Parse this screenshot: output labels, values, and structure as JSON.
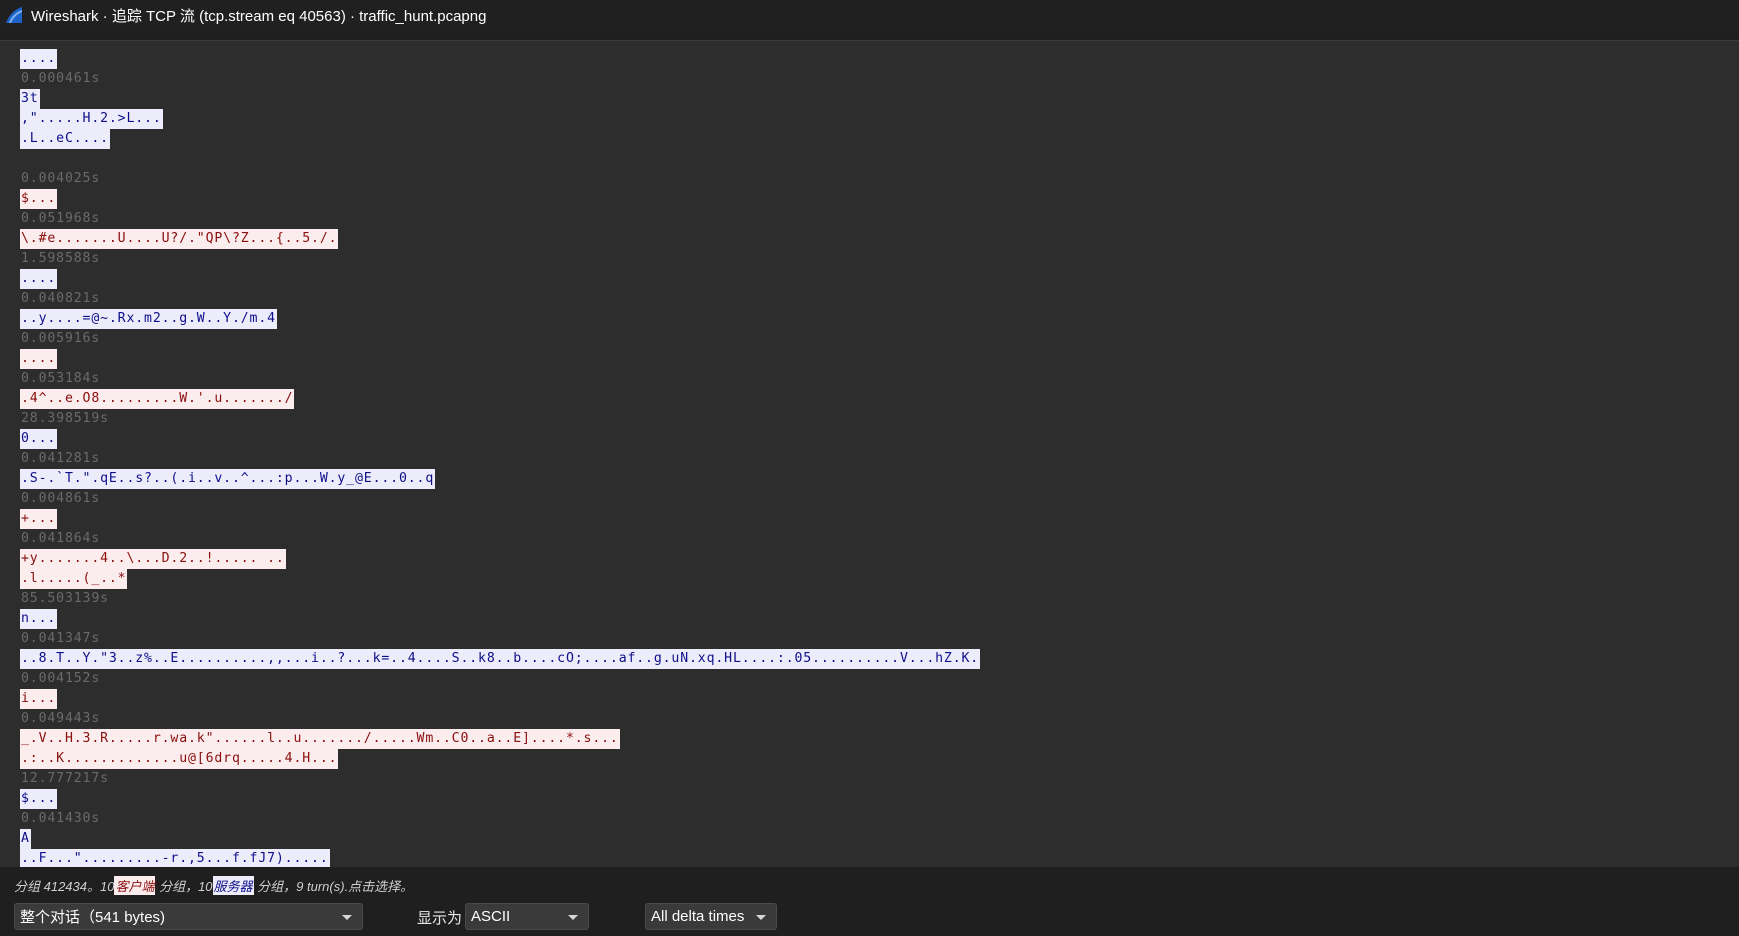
{
  "window": {
    "title": "Wireshark · 追踪 TCP 流 (tcp.stream eq 40563) · traffic_hunt.pcapng"
  },
  "stream": [
    {
      "type": "server",
      "text": "...."
    },
    {
      "type": "ts",
      "text": "0.000461s"
    },
    {
      "type": "server",
      "text": "3t"
    },
    {
      "type": "server",
      "text": ",\".....H.2.>L..."
    },
    {
      "type": "server",
      "text": ".L..eC...."
    },
    {
      "type": "blank",
      "text": ""
    },
    {
      "type": "ts",
      "text": "0.004025s"
    },
    {
      "type": "client",
      "text": "$..."
    },
    {
      "type": "ts",
      "text": "0.051968s"
    },
    {
      "type": "client",
      "text": "\\.#e.......U....U?/.\"QP\\?Z...{..5./."
    },
    {
      "type": "ts",
      "text": "1.598588s"
    },
    {
      "type": "server",
      "text": "...."
    },
    {
      "type": "ts",
      "text": "0.040821s"
    },
    {
      "type": "server",
      "text": "..y....=@~.Rx.m2..g.W..Y./m.4"
    },
    {
      "type": "ts",
      "text": "0.005916s"
    },
    {
      "type": "client",
      "text": "...."
    },
    {
      "type": "ts",
      "text": "0.053184s"
    },
    {
      "type": "client",
      "text": ".4^..e.O8.........W.'.u......./"
    },
    {
      "type": "ts",
      "text": "28.398519s"
    },
    {
      "type": "server",
      "text": "0..."
    },
    {
      "type": "ts",
      "text": "0.041281s"
    },
    {
      "type": "server",
      "text": ".S-.`T.\".qE..s?..(.i..v..^...:p...W.y_@E...0..q"
    },
    {
      "type": "ts",
      "text": "0.004861s"
    },
    {
      "type": "client",
      "text": "+..."
    },
    {
      "type": "ts",
      "text": "0.041864s"
    },
    {
      "type": "client",
      "text": "+y.......4..\\...D.2..!..... .."
    },
    {
      "type": "client",
      "text": ".l.....(_..*"
    },
    {
      "type": "ts",
      "text": "85.503139s"
    },
    {
      "type": "server",
      "text": "n..."
    },
    {
      "type": "ts",
      "text": "0.041347s"
    },
    {
      "type": "server",
      "text": "..8.T..Y.\"3..z%..E..........,,...i..?...k=..4....S..k8..b....cO;....af..g.uN.xq.HL....:.05..........V...hZ.K."
    },
    {
      "type": "ts",
      "text": "0.004152s"
    },
    {
      "type": "client",
      "text": "i..."
    },
    {
      "type": "ts",
      "text": "0.049443s"
    },
    {
      "type": "client",
      "text": "_.V..H.3.R.....r.wa.k\"......l..u......./.....Wm..C0..a..E]....*.s..."
    },
    {
      "type": "client",
      "text": ".:..K.............u@[6drq.....4.H..."
    },
    {
      "type": "ts",
      "text": "12.777217s"
    },
    {
      "type": "server",
      "text": "$..."
    },
    {
      "type": "ts",
      "text": "0.041430s"
    },
    {
      "type": "server",
      "text": "A"
    },
    {
      "type": "server",
      "text": "..F...\".........-r.,5...f.fJ7)....."
    }
  ],
  "info": {
    "prefix": "分组 412434。10",
    "client_tag": "客户端",
    "mid": " 分组，10",
    "server_tag": "服务器",
    "suffix": " 分组，9 turn(s).点击选择。"
  },
  "controls": {
    "conversation_select": "整个对话（541 bytes)",
    "show_as_label": "显示为",
    "show_as_select": "ASCII",
    "delta_select": "All delta times"
  },
  "colors": {
    "client_bg": "#fbeded",
    "client_fg": "#8a0f0f",
    "server_bg": "#ececfb",
    "server_fg": "#0f0f8a",
    "timestamp_fg": "#6a6a6a"
  }
}
